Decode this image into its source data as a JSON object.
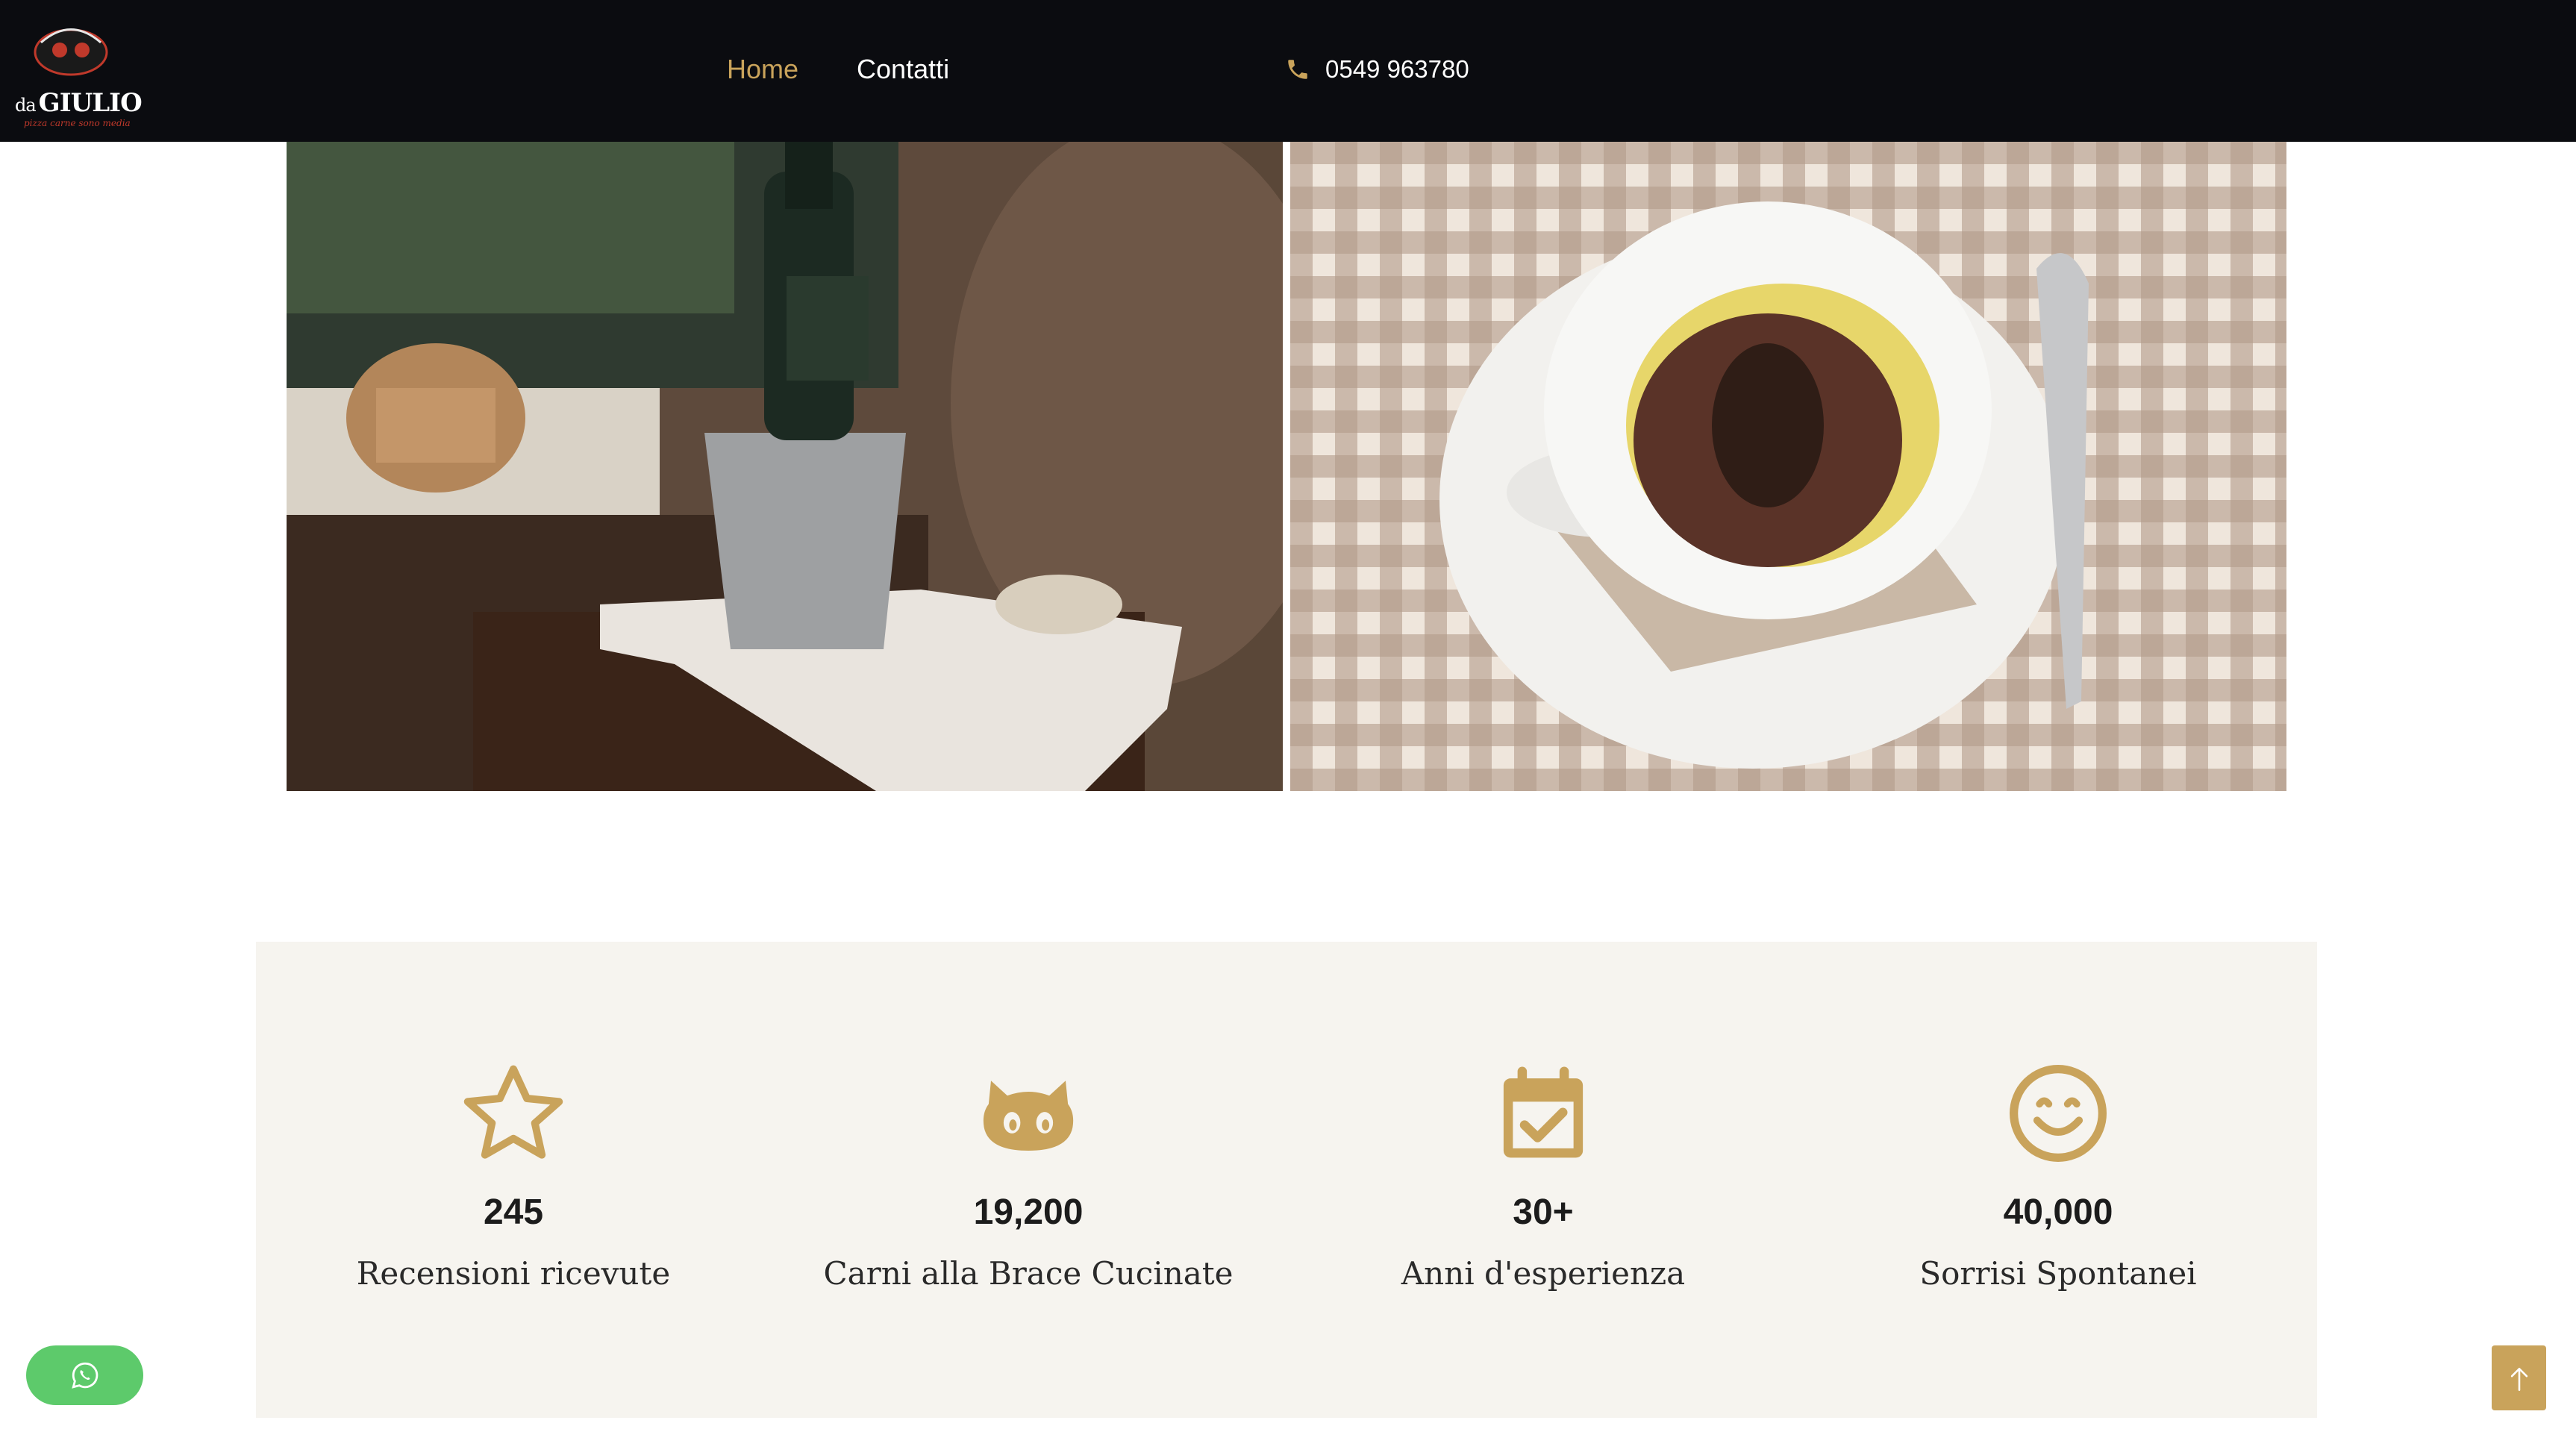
{
  "header": {
    "logo": {
      "prefix": "da",
      "name": "GIULIO",
      "tagline": "pizza carne sono media"
    },
    "nav": [
      {
        "label": "Home",
        "active": true
      },
      {
        "label": "Contatti",
        "active": false
      }
    ],
    "phone": "0549 963780"
  },
  "stats": [
    {
      "icon": "star-icon",
      "value": "245",
      "label": "Recensioni ricevute"
    },
    {
      "icon": "github-cat-icon",
      "value": "19,200",
      "label": "Carni alla Brace Cucinate"
    },
    {
      "icon": "calendar-check-icon",
      "value": "30+",
      "label": "Anni d'esperienza"
    },
    {
      "icon": "smile-icon",
      "value": "40,000",
      "label": "Sorrisi Spontanei"
    }
  ],
  "colors": {
    "accent": "#c9a35b",
    "header_bg": "#0b0c10",
    "stats_bg": "#f6f4ef",
    "whatsapp": "#5dca6b"
  }
}
